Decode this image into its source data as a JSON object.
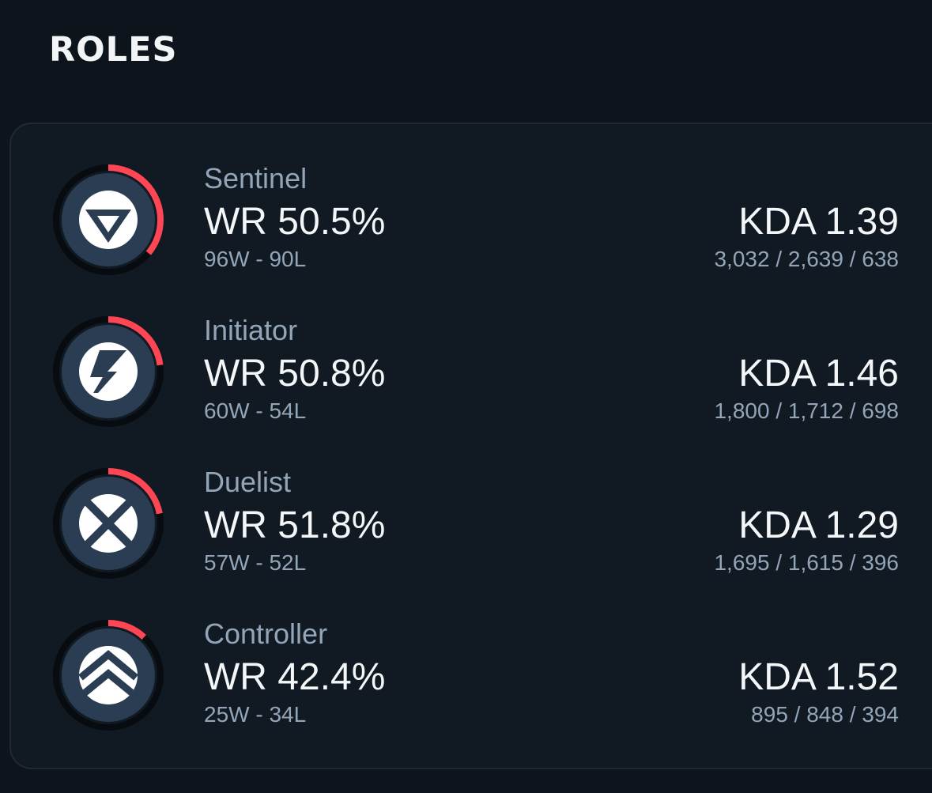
{
  "section": {
    "title": "ROLES"
  },
  "colors": {
    "accent": "#ff4655",
    "ring_track": "#080c10",
    "icon_bg": "#2a3d52",
    "card_bg": "#111a23",
    "muted_text": "#93a5b8"
  },
  "roles": [
    {
      "name": "Sentinel",
      "icon": "sentinel-icon",
      "winrate": "WR 50.5%",
      "winrate_value": 50.5,
      "record": "96W - 90L",
      "kda": "KDA 1.39",
      "kda_stats": "3,032 / 2,639 / 638",
      "ring_fill": 0.36
    },
    {
      "name": "Initiator",
      "icon": "initiator-icon",
      "winrate": "WR 50.8%",
      "winrate_value": 50.8,
      "record": "60W - 54L",
      "kda": "KDA 1.46",
      "kda_stats": "1,800 / 1,712 / 698",
      "ring_fill": 0.23
    },
    {
      "name": "Duelist",
      "icon": "duelist-icon",
      "winrate": "WR 51.8%",
      "winrate_value": 51.8,
      "record": "57W - 52L",
      "kda": "KDA 1.29",
      "kda_stats": "1,695 / 1,615 / 396",
      "ring_fill": 0.22
    },
    {
      "name": "Controller",
      "icon": "controller-icon",
      "winrate": "WR 42.4%",
      "winrate_value": 42.4,
      "record": "25W - 34L",
      "kda": "KDA 1.52",
      "kda_stats": "895 / 848 / 394",
      "ring_fill": 0.12
    }
  ]
}
